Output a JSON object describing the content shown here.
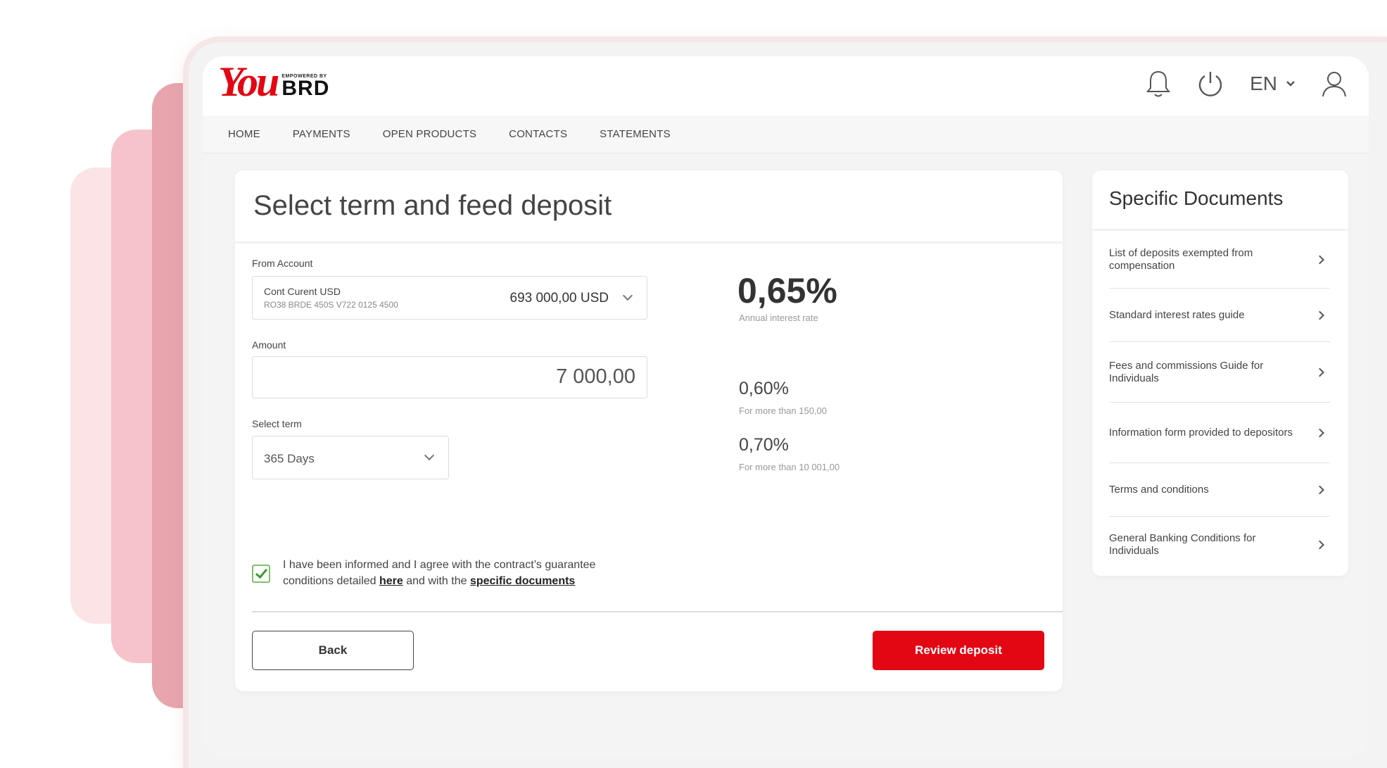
{
  "brand": {
    "logo_you": "You",
    "logo_empowered": "EMPOWERED BY",
    "logo_brd": "BRD"
  },
  "header": {
    "language": "EN"
  },
  "nav": {
    "items": [
      "HOME",
      "PAYMENTS",
      "OPEN PRODUCTS",
      "CONTACTS",
      "STATEMENTS"
    ]
  },
  "main": {
    "title": "Select term and feed deposit",
    "from_account": {
      "label": "From Account",
      "name": "Cont Curent USD",
      "iban": "RO38 BRDE 450S V722 0125 4500",
      "balance": "693 000,00 USD"
    },
    "amount": {
      "label": "Amount",
      "value": "7 000,00"
    },
    "term": {
      "label": "Select term",
      "value": "365 Days"
    },
    "rates": {
      "main_rate": "0,65%",
      "main_caption": "Annual interest rate",
      "tier1_rate": "0,60%",
      "tier1_caption": "For more than 150,00",
      "tier2_rate": "0,70%",
      "tier2_caption": "For more than 10 001,00"
    },
    "consent": {
      "checked": true,
      "text_1": "I have been informed and I agree with the contract’s guarantee conditions detailed ",
      "link_here": "here",
      "text_2": " and with the ",
      "link_docs": "specific documents"
    },
    "buttons": {
      "back": "Back",
      "review": "Review deposit"
    }
  },
  "side": {
    "title": "Specific Documents",
    "items": [
      {
        "label": "List of deposits exempted from compensation"
      },
      {
        "label": "Standard interest rates guide"
      },
      {
        "label": "Fees and commissions Guide for Individuals"
      },
      {
        "label": "Information form provided to depositors"
      },
      {
        "label": "Terms and conditions"
      },
      {
        "label": "General Banking Conditions for Individuals"
      }
    ]
  },
  "colors": {
    "brand_red": "#e30613",
    "check_green": "#3a9a2e"
  },
  "icons": [
    "bell-icon",
    "power-icon",
    "chevron-down-icon",
    "user-icon",
    "chevron-right-icon",
    "check-icon"
  ]
}
